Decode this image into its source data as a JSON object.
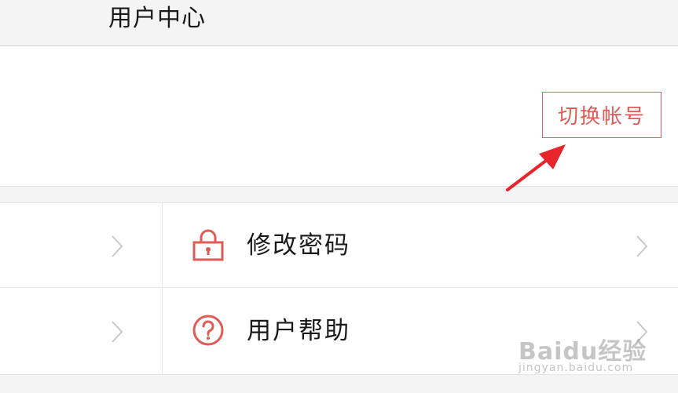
{
  "header": {
    "title": "用户中心"
  },
  "profile": {
    "switch_account_label": "切换帐号"
  },
  "menu": {
    "items": [
      {
        "label": "修改密码",
        "icon": "lock-icon"
      },
      {
        "label": "用户帮助",
        "icon": "help-icon"
      }
    ]
  },
  "watermark": {
    "brand": "Baidu经验",
    "sub": "jingyan.baidu.com"
  },
  "colors": {
    "accent": "#e05a56",
    "arrow": "#e8252a",
    "background": "#f4f4f4",
    "divider": "#e6e6e6"
  }
}
